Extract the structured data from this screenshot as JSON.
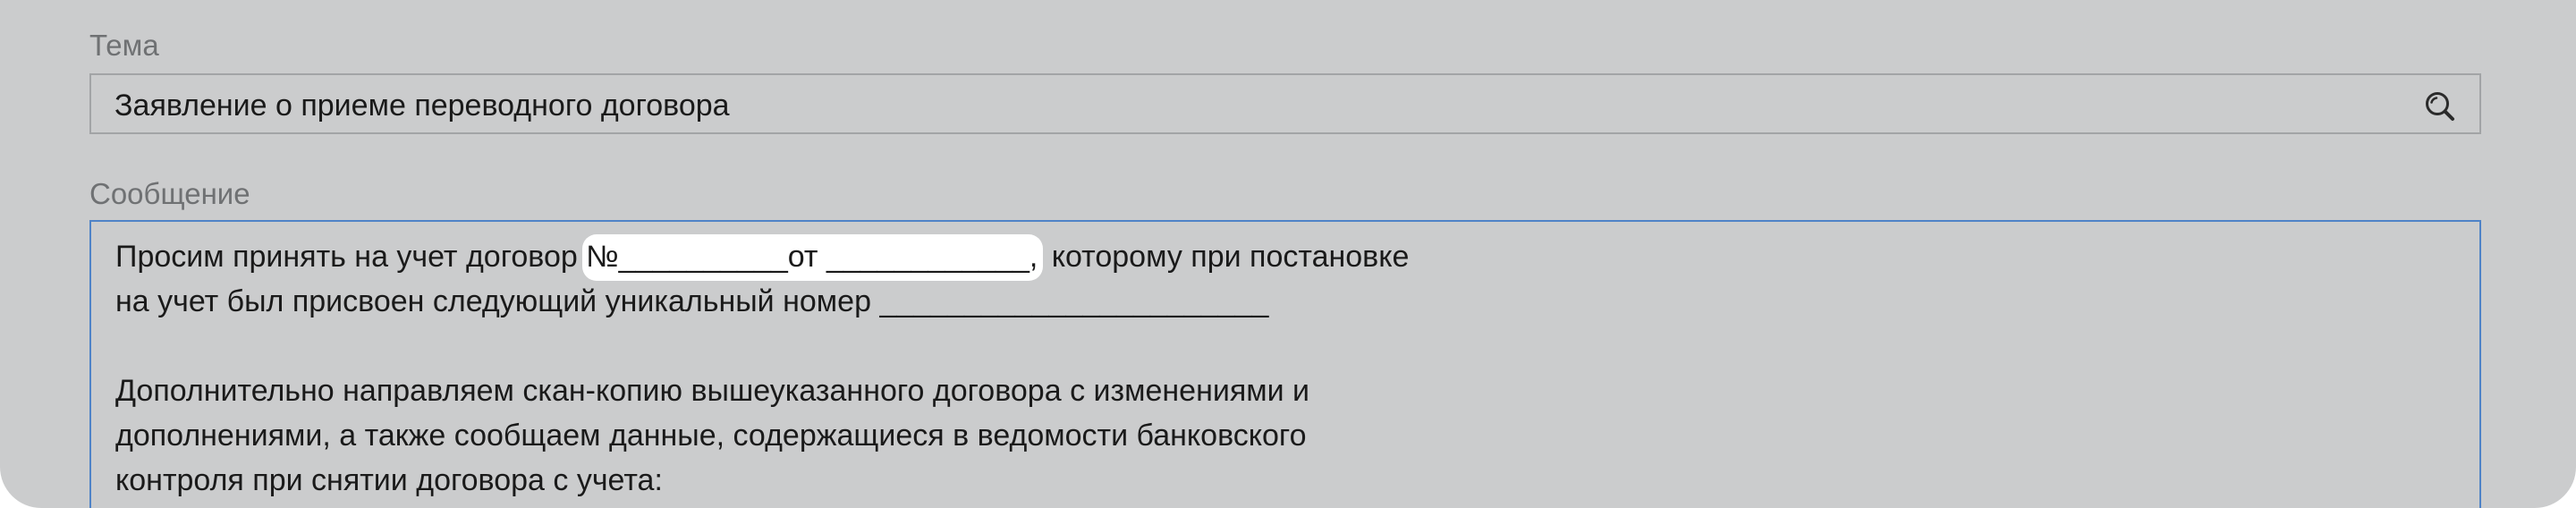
{
  "subject": {
    "label": "Тема",
    "value": "Заявление о приеме переводного договора",
    "search_icon": "search-icon"
  },
  "message": {
    "label": "Сообщение",
    "line1_before": "Просим принять на учет договор ",
    "line1_highlight": "№__________от ____________,",
    "line1_after": " которому при постановке",
    "line2": "на учет был присвоен следующий уникальный номер _______________________",
    "line3": "Дополнительно направляем скан-копию вышеуказанного договора с изменениями и",
    "line4": "дополнениями, а также сообщаем данные, содержащиеся в ведомости банковского",
    "line5": "контроля при снятии договора с учета:"
  },
  "colors": {
    "panel_bg": "#cbcccd",
    "label": "#6f7173",
    "focus_border": "#4f83c7",
    "highlight": "#ffffff"
  }
}
